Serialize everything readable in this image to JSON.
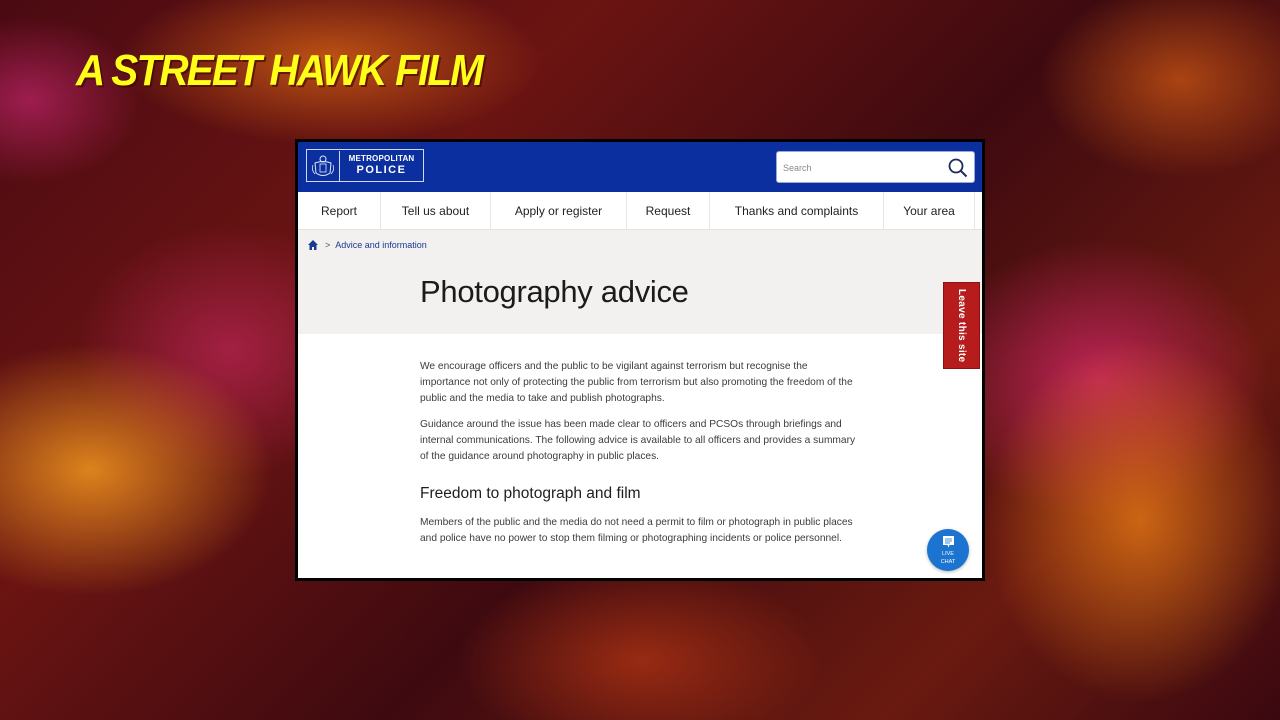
{
  "overlay": {
    "title": "A STREET HAWK FILM",
    "title_color": "#ffff1a"
  },
  "site": {
    "logo": {
      "line1": "METROPOLITAN",
      "line2": "POLICE"
    },
    "header_color": "#0c2fa0",
    "search": {
      "placeholder": "Search",
      "value": ""
    },
    "nav": [
      {
        "label": "Report"
      },
      {
        "label": "Tell us about"
      },
      {
        "label": "Apply or register"
      },
      {
        "label": "Request"
      },
      {
        "label": "Thanks and complaints"
      },
      {
        "label": "Your area"
      }
    ],
    "breadcrumb": {
      "separator": ">",
      "items": [
        {
          "label": "Advice and information"
        }
      ]
    },
    "page_title": "Photography advice",
    "paragraphs": [
      "We encourage officers and the public to be vigilant against terrorism but recognise the importance not only of protecting the public from terrorism but also promoting the freedom of the public and the media to take and publish photographs.",
      "Guidance around the issue has been made clear to officers and PCSOs through briefings and internal communications. The following advice is available to all officers and provides a summary of the guidance around photography in public places."
    ],
    "section": {
      "heading": "Freedom to photograph and film",
      "paragraph": "Members of the public and the media do not need a permit to film or photograph in public places and police have no power to stop them filming or photographing incidents or police personnel."
    },
    "leave_site": {
      "label": "Leave this site",
      "color": "#b71c1c"
    },
    "live_chat": {
      "line1": "LIVE",
      "line2": "CHAT",
      "color": "#1b75d0"
    }
  }
}
